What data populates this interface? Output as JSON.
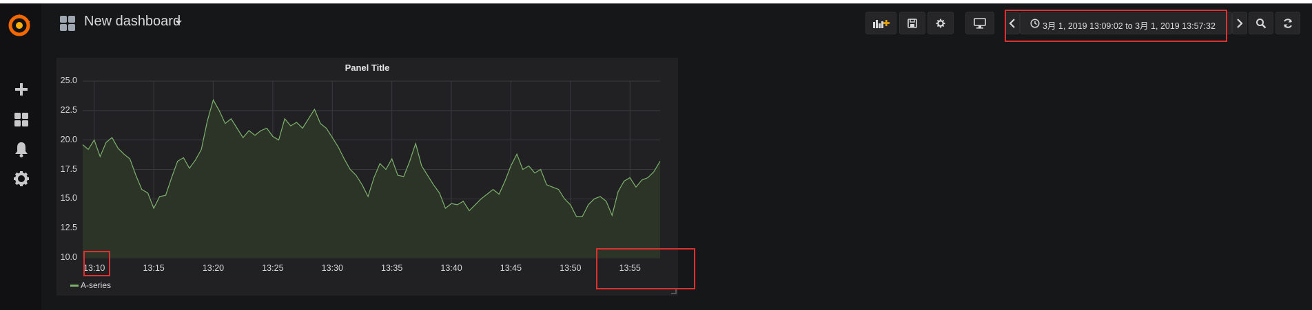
{
  "app": {
    "dashboard_title": "New dashboard"
  },
  "sidebar": {
    "items": [
      {
        "icon": "plus-icon",
        "label": "Create"
      },
      {
        "icon": "dashboards-grid-icon",
        "label": "Dashboards"
      },
      {
        "icon": "bell-icon",
        "label": "Alerting"
      },
      {
        "icon": "gear-icon",
        "label": "Configuration"
      }
    ]
  },
  "toolbar": {
    "buttons": [
      "add-panel-icon",
      "save-icon",
      "gear-icon",
      "monitor-icon"
    ],
    "time_range": "3月 1, 2019 13:09:02 to 3月 1, 2019 13:57:32",
    "time_nav": [
      "chevron-left-icon",
      "chevron-right-icon",
      "zoom-out-icon",
      "refresh-icon"
    ]
  },
  "panel": {
    "title": "Panel Title",
    "legend_label": "A-series"
  },
  "colors": {
    "series_line": "#7eb26d",
    "series_fill": "#2c3327",
    "highlight": "#e02f2f"
  },
  "chart_data": {
    "type": "area",
    "title": "Panel Title",
    "xlabel": "",
    "ylabel": "",
    "x_range": [
      "13:09:02",
      "13:57:32"
    ],
    "xticks": [
      "13:10",
      "13:15",
      "13:20",
      "13:25",
      "13:30",
      "13:35",
      "13:40",
      "13:45",
      "13:50",
      "13:55"
    ],
    "yticks": [
      "10.0",
      "12.5",
      "15.0",
      "17.5",
      "20.0",
      "22.5",
      "25.0"
    ],
    "ylim": [
      10,
      25
    ],
    "grid": true,
    "legend": "bottom-left",
    "series": [
      {
        "name": "A-series",
        "points": [
          [
            "13:09:02",
            19.6
          ],
          [
            "13:09:30",
            19.2
          ],
          [
            "13:10:00",
            20.0
          ],
          [
            "13:10:30",
            18.6
          ],
          [
            "13:11:00",
            19.8
          ],
          [
            "13:11:30",
            20.2
          ],
          [
            "13:12:00",
            19.3
          ],
          [
            "13:12:30",
            18.8
          ],
          [
            "13:13:00",
            18.4
          ],
          [
            "13:13:30",
            17.0
          ],
          [
            "13:14:00",
            15.8
          ],
          [
            "13:14:30",
            15.5
          ],
          [
            "13:15:00",
            14.2
          ],
          [
            "13:15:30",
            15.2
          ],
          [
            "13:16:00",
            15.3
          ],
          [
            "13:16:30",
            16.8
          ],
          [
            "13:17:00",
            18.2
          ],
          [
            "13:17:30",
            18.5
          ],
          [
            "13:18:00",
            17.6
          ],
          [
            "13:18:30",
            18.3
          ],
          [
            "13:19:00",
            19.2
          ],
          [
            "13:19:30",
            21.6
          ],
          [
            "13:20:00",
            23.4
          ],
          [
            "13:20:30",
            22.5
          ],
          [
            "13:21:00",
            21.4
          ],
          [
            "13:21:30",
            21.8
          ],
          [
            "13:22:00",
            21.0
          ],
          [
            "13:22:30",
            20.2
          ],
          [
            "13:23:00",
            20.8
          ],
          [
            "13:23:30",
            20.4
          ],
          [
            "13:24:00",
            20.8
          ],
          [
            "13:24:30",
            21.0
          ],
          [
            "13:25:00",
            20.3
          ],
          [
            "13:25:30",
            20.0
          ],
          [
            "13:26:00",
            21.8
          ],
          [
            "13:26:30",
            21.2
          ],
          [
            "13:27:00",
            21.5
          ],
          [
            "13:27:30",
            21.0
          ],
          [
            "13:28:00",
            21.8
          ],
          [
            "13:28:30",
            22.6
          ],
          [
            "13:29:00",
            21.4
          ],
          [
            "13:29:30",
            21.0
          ],
          [
            "13:30:00",
            20.2
          ],
          [
            "13:30:30",
            19.4
          ],
          [
            "13:31:00",
            18.4
          ],
          [
            "13:31:30",
            17.5
          ],
          [
            "13:32:00",
            17.0
          ],
          [
            "13:32:30",
            16.2
          ],
          [
            "13:33:00",
            15.2
          ],
          [
            "13:33:30",
            16.8
          ],
          [
            "13:34:00",
            18.0
          ],
          [
            "13:34:30",
            17.5
          ],
          [
            "13:35:00",
            18.4
          ],
          [
            "13:35:30",
            17.0
          ],
          [
            "13:36:00",
            16.9
          ],
          [
            "13:36:30",
            18.2
          ],
          [
            "13:37:00",
            19.7
          ],
          [
            "13:37:30",
            17.8
          ],
          [
            "13:38:00",
            17.0
          ],
          [
            "13:38:30",
            16.2
          ],
          [
            "13:39:00",
            15.5
          ],
          [
            "13:39:30",
            14.2
          ],
          [
            "13:40:00",
            14.6
          ],
          [
            "13:40:30",
            14.5
          ],
          [
            "13:41:00",
            14.8
          ],
          [
            "13:41:30",
            14.0
          ],
          [
            "13:42:00",
            14.5
          ],
          [
            "13:42:30",
            15.0
          ],
          [
            "13:43:00",
            15.4
          ],
          [
            "13:43:30",
            15.8
          ],
          [
            "13:44:00",
            15.4
          ],
          [
            "13:44:30",
            16.5
          ],
          [
            "13:45:00",
            17.8
          ],
          [
            "13:45:30",
            18.8
          ],
          [
            "13:46:00",
            17.5
          ],
          [
            "13:46:30",
            17.8
          ],
          [
            "13:47:00",
            17.2
          ],
          [
            "13:47:30",
            17.5
          ],
          [
            "13:48:00",
            16.2
          ],
          [
            "13:48:30",
            16.0
          ],
          [
            "13:49:00",
            15.8
          ],
          [
            "13:49:30",
            15.0
          ],
          [
            "13:50:00",
            14.5
          ],
          [
            "13:50:30",
            13.5
          ],
          [
            "13:51:00",
            13.5
          ],
          [
            "13:51:30",
            14.5
          ],
          [
            "13:52:00",
            15.0
          ],
          [
            "13:52:30",
            15.2
          ],
          [
            "13:53:00",
            14.8
          ],
          [
            "13:53:30",
            13.6
          ],
          [
            "13:54:00",
            15.6
          ],
          [
            "13:54:30",
            16.5
          ],
          [
            "13:55:00",
            16.8
          ],
          [
            "13:55:30",
            16.0
          ],
          [
            "13:56:00",
            16.6
          ],
          [
            "13:56:30",
            16.8
          ],
          [
            "13:57:00",
            17.3
          ],
          [
            "13:57:32",
            18.2
          ]
        ]
      }
    ]
  }
}
